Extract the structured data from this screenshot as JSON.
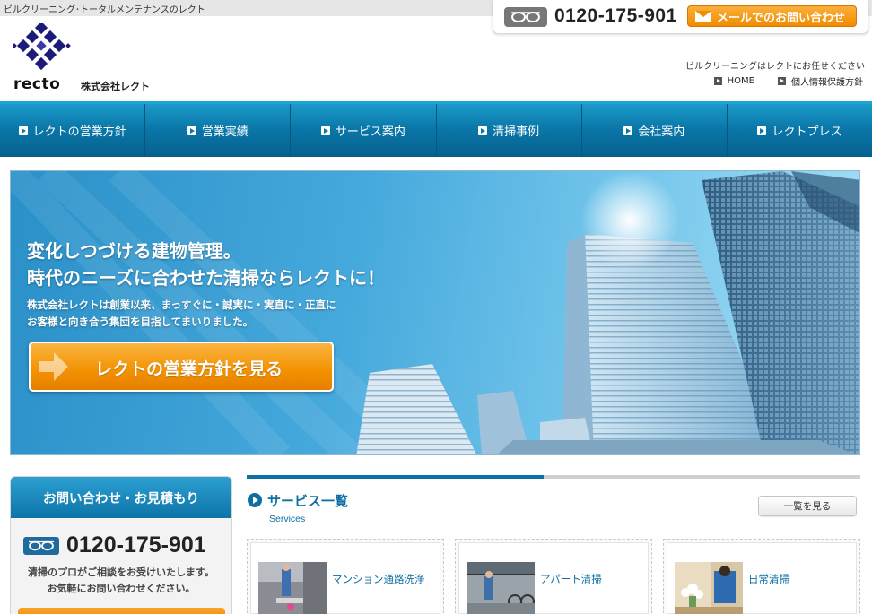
{
  "header": {
    "tagline": "ビルクリーニング･トータルメンテナンスのレクト",
    "phone": "0120-175-901",
    "mail_button": "メールでのお問い合わせ",
    "logo_text": "recto",
    "company_name": "株式会社レクト",
    "subtagline": "ビルクリーニングはレクトにお任せください",
    "links": [
      "HOME",
      "個人情報保護方針"
    ]
  },
  "nav": {
    "items": [
      "レクトの営業方針",
      "営業実績",
      "サービス案内",
      "清掃事例",
      "会社案内",
      "レクトプレス"
    ]
  },
  "hero": {
    "headline_1": "変化しつづける建物管理。",
    "headline_2": "時代のニーズに合わせた清掃ならレクトに！",
    "body_1": "株式会社レクトは創業以来、まっすぐに・誠実に・実直に・正直に",
    "body_2": "お客様と向き合う集団を目指してまいりました。",
    "button": "レクトの営業方針を見る"
  },
  "inquiry": {
    "title": "お問い合わせ・お見積もり",
    "phone": "0120-175-901",
    "text_1": "清掃のプロがご相談をお受けいたします。",
    "text_2": "お気軽にお問い合わせください。"
  },
  "services": {
    "title": "サービス一覧",
    "subtitle": "Services",
    "more_button": "一覧を見る",
    "cards": [
      {
        "label": "マンション通路洗浄"
      },
      {
        "label": "アパート清掃"
      },
      {
        "label": "日常清掃"
      }
    ]
  },
  "colors": {
    "brand_blue": "#0d6fa3",
    "accent_orange": "#f29100",
    "logo_navy": "#1c1a7a"
  },
  "icons": [
    "freedial-icon",
    "mail-icon",
    "arrow-right-icon",
    "logo-mark"
  ]
}
